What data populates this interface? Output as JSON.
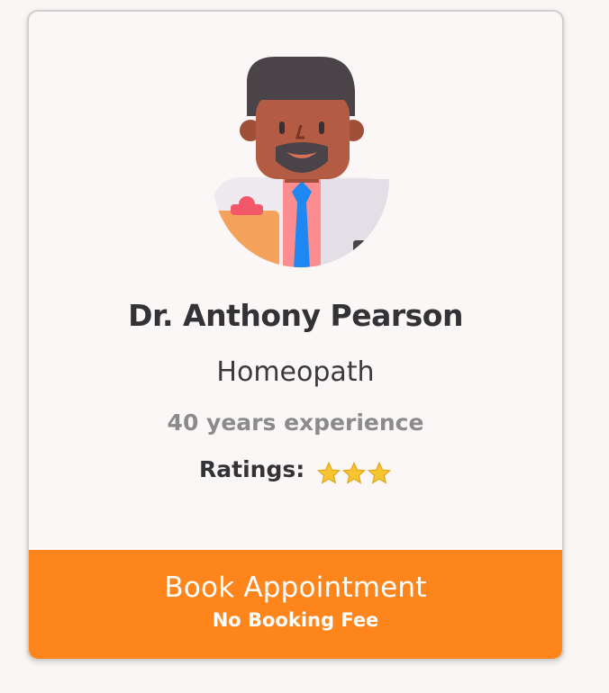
{
  "doctor": {
    "name": "Dr. Anthony Pearson",
    "specialty": "Homeopath",
    "experience": "40 years experience",
    "ratings_label": "Ratings:",
    "rating_stars": 3,
    "avatar_icon": "doctor-avatar-icon"
  },
  "booking": {
    "button_label": "Book Appointment",
    "fee_note": "No Booking Fee"
  },
  "colors": {
    "accent": "#fd851b",
    "star": "#f7c531"
  }
}
